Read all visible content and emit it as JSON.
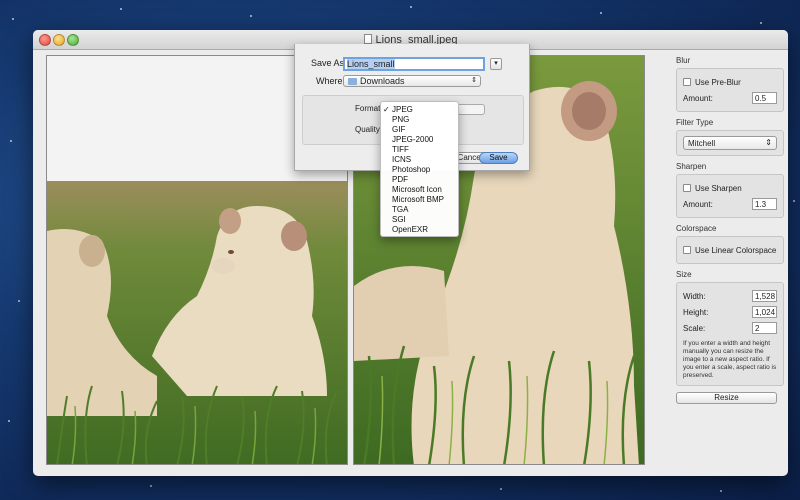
{
  "window": {
    "title": "Lions_small.jpeg"
  },
  "save_dialog": {
    "save_as_label": "Save As:",
    "save_as_value": "Lions_small",
    "where_label": "Where:",
    "where_value": "Downloads",
    "format_label": "Format",
    "quality_label": "Quality",
    "cancel_label": "Cancel",
    "save_label": "Save",
    "expand_icon": "chevron-down-icon"
  },
  "format_menu": {
    "selected": "JPEG",
    "items": [
      "JPEG",
      "PNG",
      "GIF",
      "JPEG-2000",
      "TIFF",
      "ICNS",
      "Photoshop",
      "PDF",
      "Microsoft Icon",
      "Microsoft BMP",
      "TGA",
      "SGI",
      "OpenEXR"
    ]
  },
  "sidebar": {
    "blur": {
      "title": "Blur",
      "use_preblur": "Use Pre-Blur",
      "amount_label": "Amount:",
      "amount_value": "0.5"
    },
    "filter": {
      "title": "Filter Type",
      "value": "Mitchell"
    },
    "sharpen": {
      "title": "Sharpen",
      "use_sharpen": "Use Sharpen",
      "amount_label": "Amount:",
      "amount_value": "1.3"
    },
    "colorspace": {
      "title": "Colorspace",
      "use_linear": "Use Linear Colorspace"
    },
    "size": {
      "title": "Size",
      "width_label": "Width:",
      "width_value": "1,528",
      "height_label": "Height:",
      "height_value": "1,024",
      "scale_label": "Scale:",
      "scale_value": "2",
      "note": "If you enter a width and height manually you can resize the image to a new aspect ratio. If you enter a scale, aspect ratio is preserved."
    },
    "resize_label": "Resize"
  },
  "colors": {
    "accent": "#6ea2e0",
    "save_button": "#6aa0e2",
    "desktop": "#163a72"
  }
}
